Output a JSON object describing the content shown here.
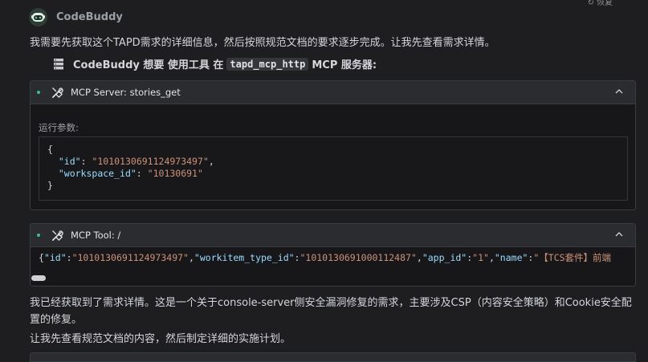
{
  "retry_label": "恢复",
  "header": {
    "app_name": "CodeBuddy"
  },
  "intro_text": "我需要先获取这个TAPD需求的详细信息，然后按照规范文档的要求逐步完成。让我先查看需求详情。",
  "tool_request": {
    "prefix": "CodeBuddy 想要 使用工具 在",
    "server": "tapd_mcp_http",
    "suffix": "MCP 服务器:"
  },
  "card_server": {
    "title": "MCP Server: stories_get",
    "params_label": "运行参数:",
    "params": {
      "id": "1010130691124973497",
      "workspace_id": "10130691"
    }
  },
  "card_tool": {
    "title": "MCP Tool: /",
    "json_text": "{\"id\":\"1010130691124973497\",\"workitem_type_id\":\"1010130691000112487\",\"app_id\":\"1\",\"name\":\"【TCS套件】前端"
  },
  "result_text": "我已经获取到了需求详情。这是一个关于console-server侧安全漏洞修复的需求，主要涉及CSP（内容安全策略）和Cookie安全配置的修复。",
  "next_text": "让我先查看规范文档的内容，然后制定详细的实施计划。",
  "colors": {
    "accent_green": "#3fbf7f",
    "background": "#1e1e21",
    "key": "#9cdcfe",
    "string": "#ce9178"
  }
}
